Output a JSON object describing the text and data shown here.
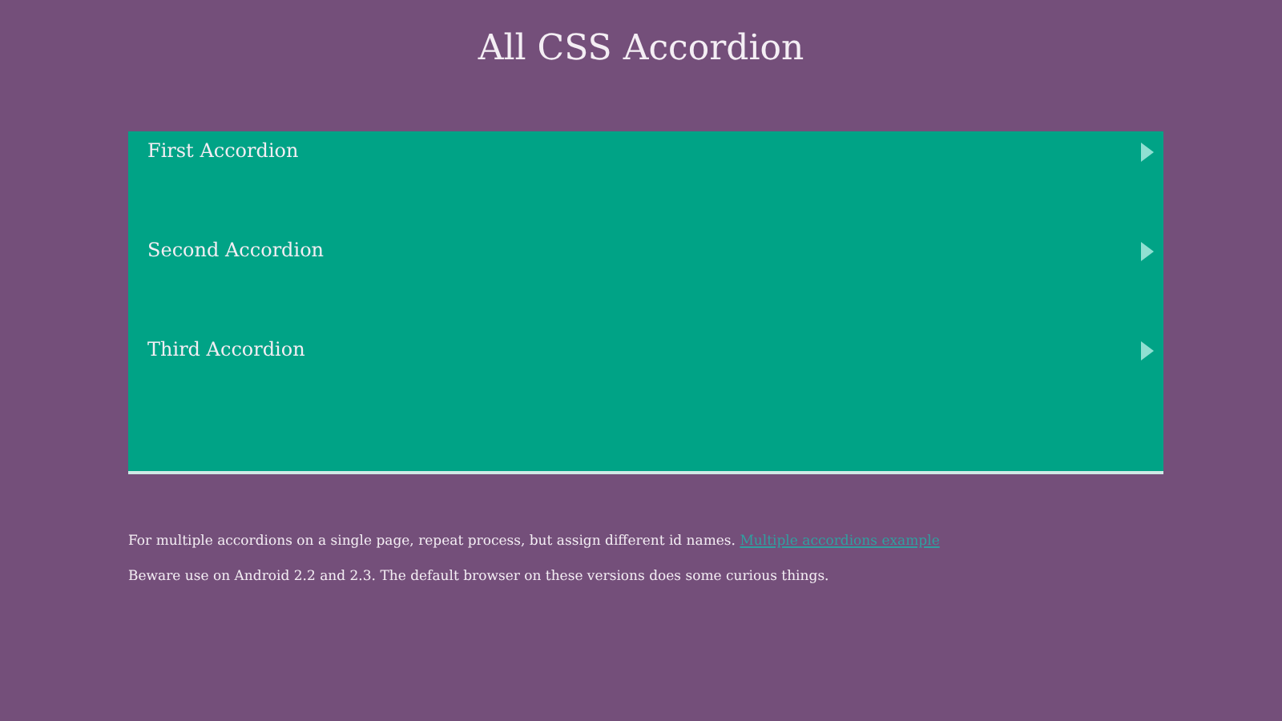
{
  "title": "All CSS Accordion",
  "accordion": [
    {
      "label": "First Accordion",
      "expanded": false
    },
    {
      "label": "Second Accordion",
      "expanded": false
    },
    {
      "label": "Third Accordion",
      "expanded": false
    }
  ],
  "notes": [
    {
      "text": "For multiple accordions on a single page, repeat process, but assign different id names.",
      "link": "Multiple accordions example"
    },
    {
      "text": "Beware use on Android 2.2 and 2.3. The default browser on these versions does some curious things."
    }
  ]
}
